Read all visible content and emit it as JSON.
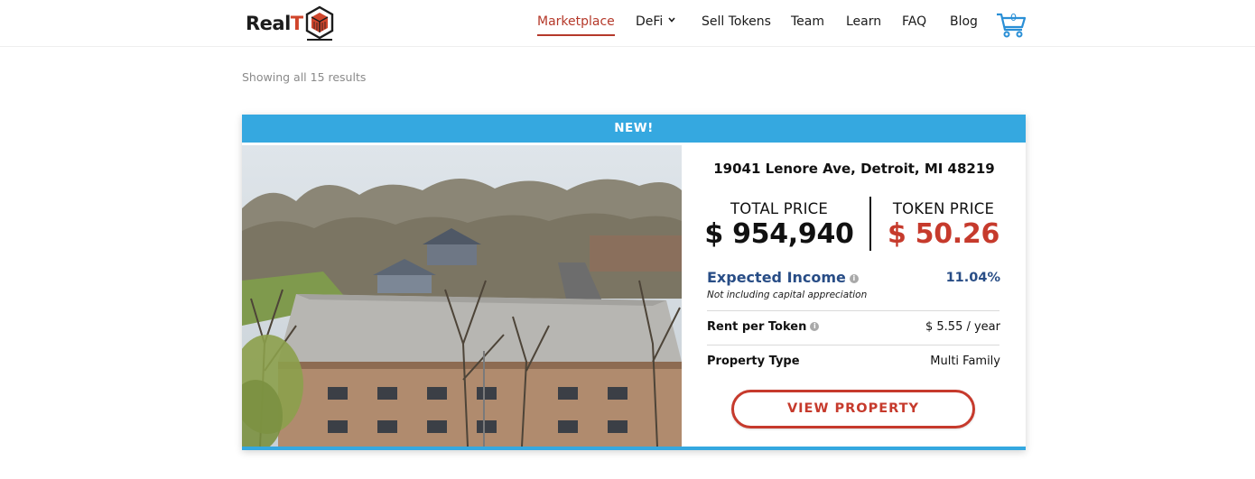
{
  "brand": {
    "logo_text_main": "Real",
    "logo_text_accent": "T",
    "accent_color": "#b5392a",
    "banner_color": "#35a8e0"
  },
  "nav": {
    "items": [
      {
        "label": "Marketplace",
        "active": true
      },
      {
        "label": "DeFi",
        "has_dropdown": true
      },
      {
        "label": "Sell Tokens"
      },
      {
        "label": "Team"
      },
      {
        "label": "Learn"
      },
      {
        "label": "FAQ"
      },
      {
        "label": "Blog"
      }
    ],
    "cart_count": "0",
    "cart_icon": "shopping-cart-icon"
  },
  "results": {
    "text": "Showing all 15 results"
  },
  "listing": {
    "banner": "NEW!",
    "address": "19041 Lenore Ave, Detroit, MI 48219",
    "total_price_label": "TOTAL PRICE",
    "total_price": "$ 954,940",
    "token_price_label": "TOKEN PRICE",
    "token_price": "$ 50.26",
    "expected_income_label": "Expected Income",
    "expected_income_value": "11.04%",
    "expected_income_note": "Not including capital appreciation",
    "rent_label": "Rent per Token",
    "rent_value": "$ 5.55 / year",
    "type_label": "Property Type",
    "type_value": "Multi Family",
    "cta": "VIEW PROPERTY",
    "info_icon": "info-icon",
    "photo_description_icon": "property-photo"
  }
}
